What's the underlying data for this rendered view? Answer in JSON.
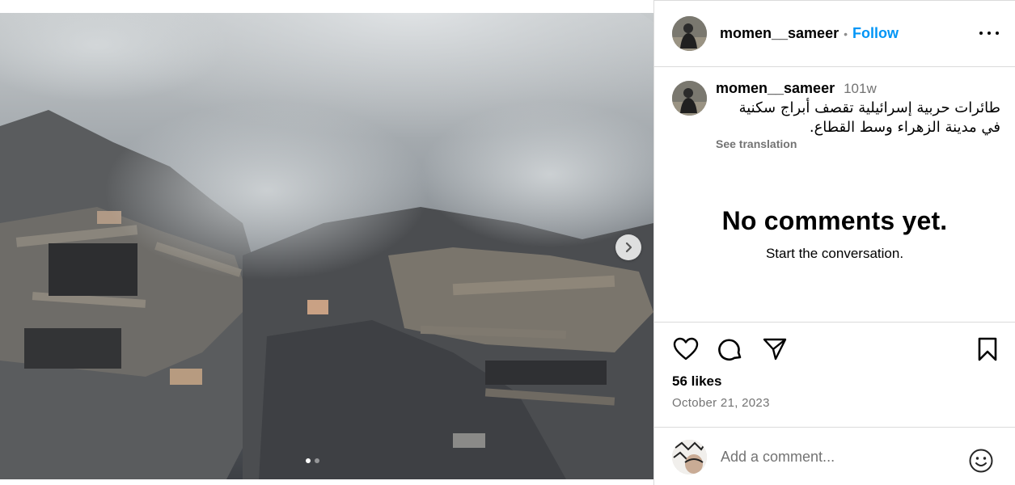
{
  "post": {
    "username": "momen__sameer",
    "follow_label": "Follow",
    "separator": "•",
    "caption": {
      "username": "momen__sameer",
      "age": "101w",
      "text": "طائرات حربية إسرائيلية تقصف أبراج سكنية في مدينة الزهراء وسط القطاع.",
      "see_translation": "See translation"
    },
    "comments": {
      "empty_title": "No comments yet.",
      "empty_subtitle": "Start the conversation."
    },
    "likes": "56 likes",
    "date": "October 21, 2023",
    "comment_placeholder": "Add a comment...",
    "carousel": {
      "count": 2,
      "active_index": 0
    }
  },
  "icons": {
    "like": "heart-icon",
    "comment": "comment-bubble-icon",
    "share": "paper-plane-icon",
    "save": "bookmark-icon",
    "more": "more-options-icon",
    "next": "chevron-right-icon",
    "emoji": "emoji-smile-icon"
  },
  "colors": {
    "accent": "#0095f6",
    "muted": "#737373",
    "divider": "#dbdbdb"
  }
}
